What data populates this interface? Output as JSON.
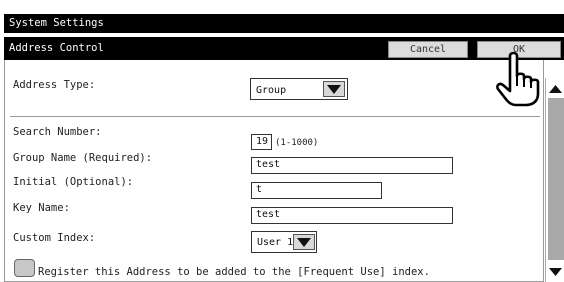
{
  "header": {
    "title": "System Settings",
    "subtitle": "Address Control",
    "cancel_label": "Cancel",
    "ok_label": "OK"
  },
  "address_type": {
    "label": "Address Type:",
    "value": "Group"
  },
  "search_number": {
    "label": "Search Number:",
    "value": "19",
    "range": "(1-1000)"
  },
  "group_name": {
    "label": "Group Name (Required):",
    "value": "test"
  },
  "initial": {
    "label": "Initial (Optional):",
    "value": "t"
  },
  "key_name": {
    "label": "Key Name:",
    "value": "test"
  },
  "custom_index": {
    "label": "Custom Index:",
    "value": "User 1"
  },
  "frequent_use": {
    "label": "Register this Address to be added to the [Frequent Use] index.",
    "checked": false
  },
  "icons": {
    "dropdown": "triangle-down-icon",
    "scroll_up": "arrow-up-icon",
    "scroll_down": "arrow-down-icon",
    "pointer": "hand-pointer-icon"
  },
  "colors": {
    "title_bar": "#000000",
    "button_face": "#dcdcdc",
    "scroll_thumb": "#a9a9a9"
  }
}
